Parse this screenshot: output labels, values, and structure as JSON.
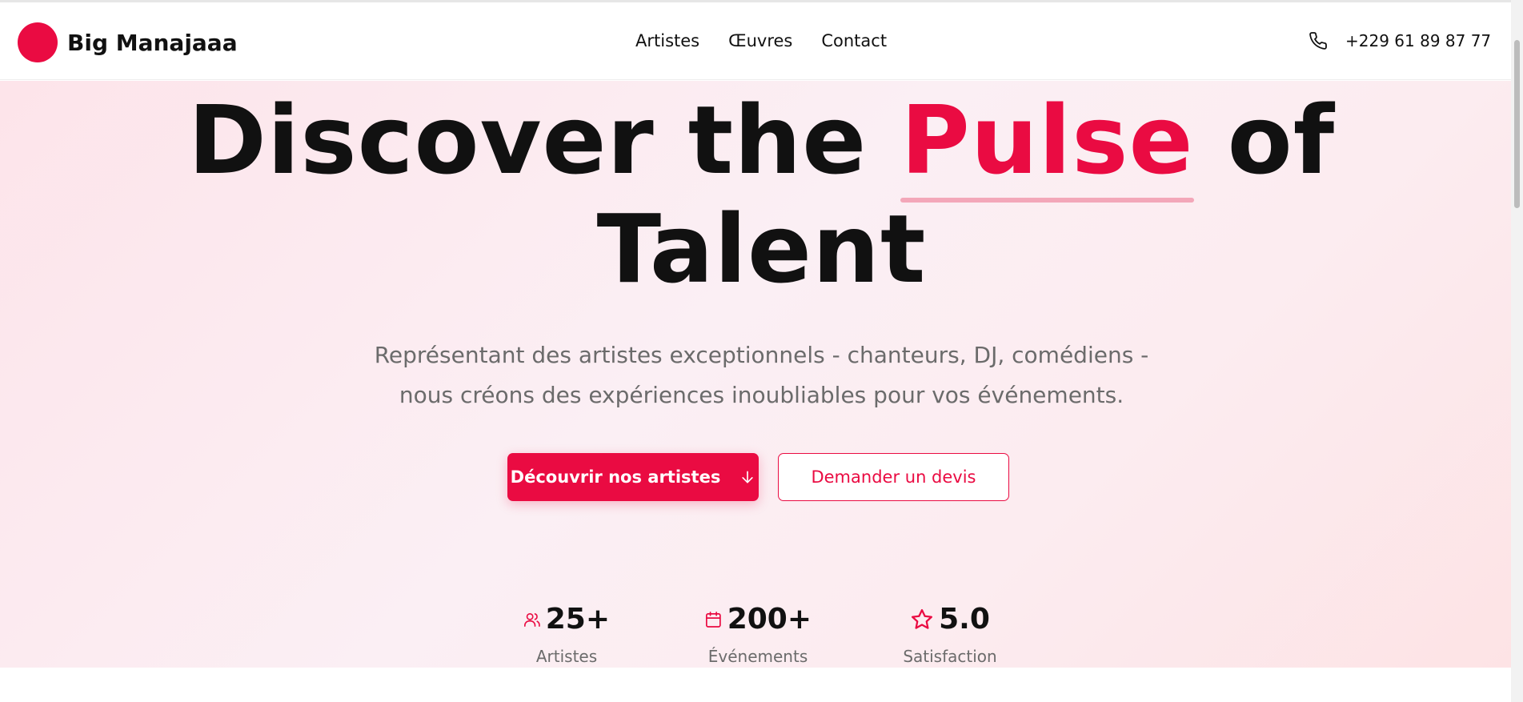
{
  "brand": {
    "name": "Big Manajaaa",
    "logo_color": "#ea0b42"
  },
  "nav": {
    "items": [
      {
        "label": "Artistes"
      },
      {
        "label": "Œuvres"
      },
      {
        "label": "Contact"
      }
    ]
  },
  "contact": {
    "phone": "+229 61 89 87 77",
    "icon": "phone-icon"
  },
  "hero": {
    "headline_before": "Discover the",
    "headline_accent": "Pulse",
    "headline_after": "of",
    "headline_line2": "Talent",
    "subtitle_line1": "Représentant des artistes exceptionnels - chanteurs, DJ, comédiens -",
    "subtitle_line2": "nous créons des expériences inoubliables pour vos événements.",
    "primary_cta": "Découvrir nos artistes",
    "secondary_cta": "Demander un devis"
  },
  "stats": [
    {
      "value": "25+",
      "label": "Artistes",
      "icon": "users-icon"
    },
    {
      "value": "200+",
      "label": "Événements",
      "icon": "calendar-icon"
    },
    {
      "value": "5.0",
      "label": "Satisfaction",
      "icon": "star-icon"
    }
  ],
  "colors": {
    "accent": "#ea0b42",
    "text": "#111111",
    "muted": "#6b6b6b"
  }
}
